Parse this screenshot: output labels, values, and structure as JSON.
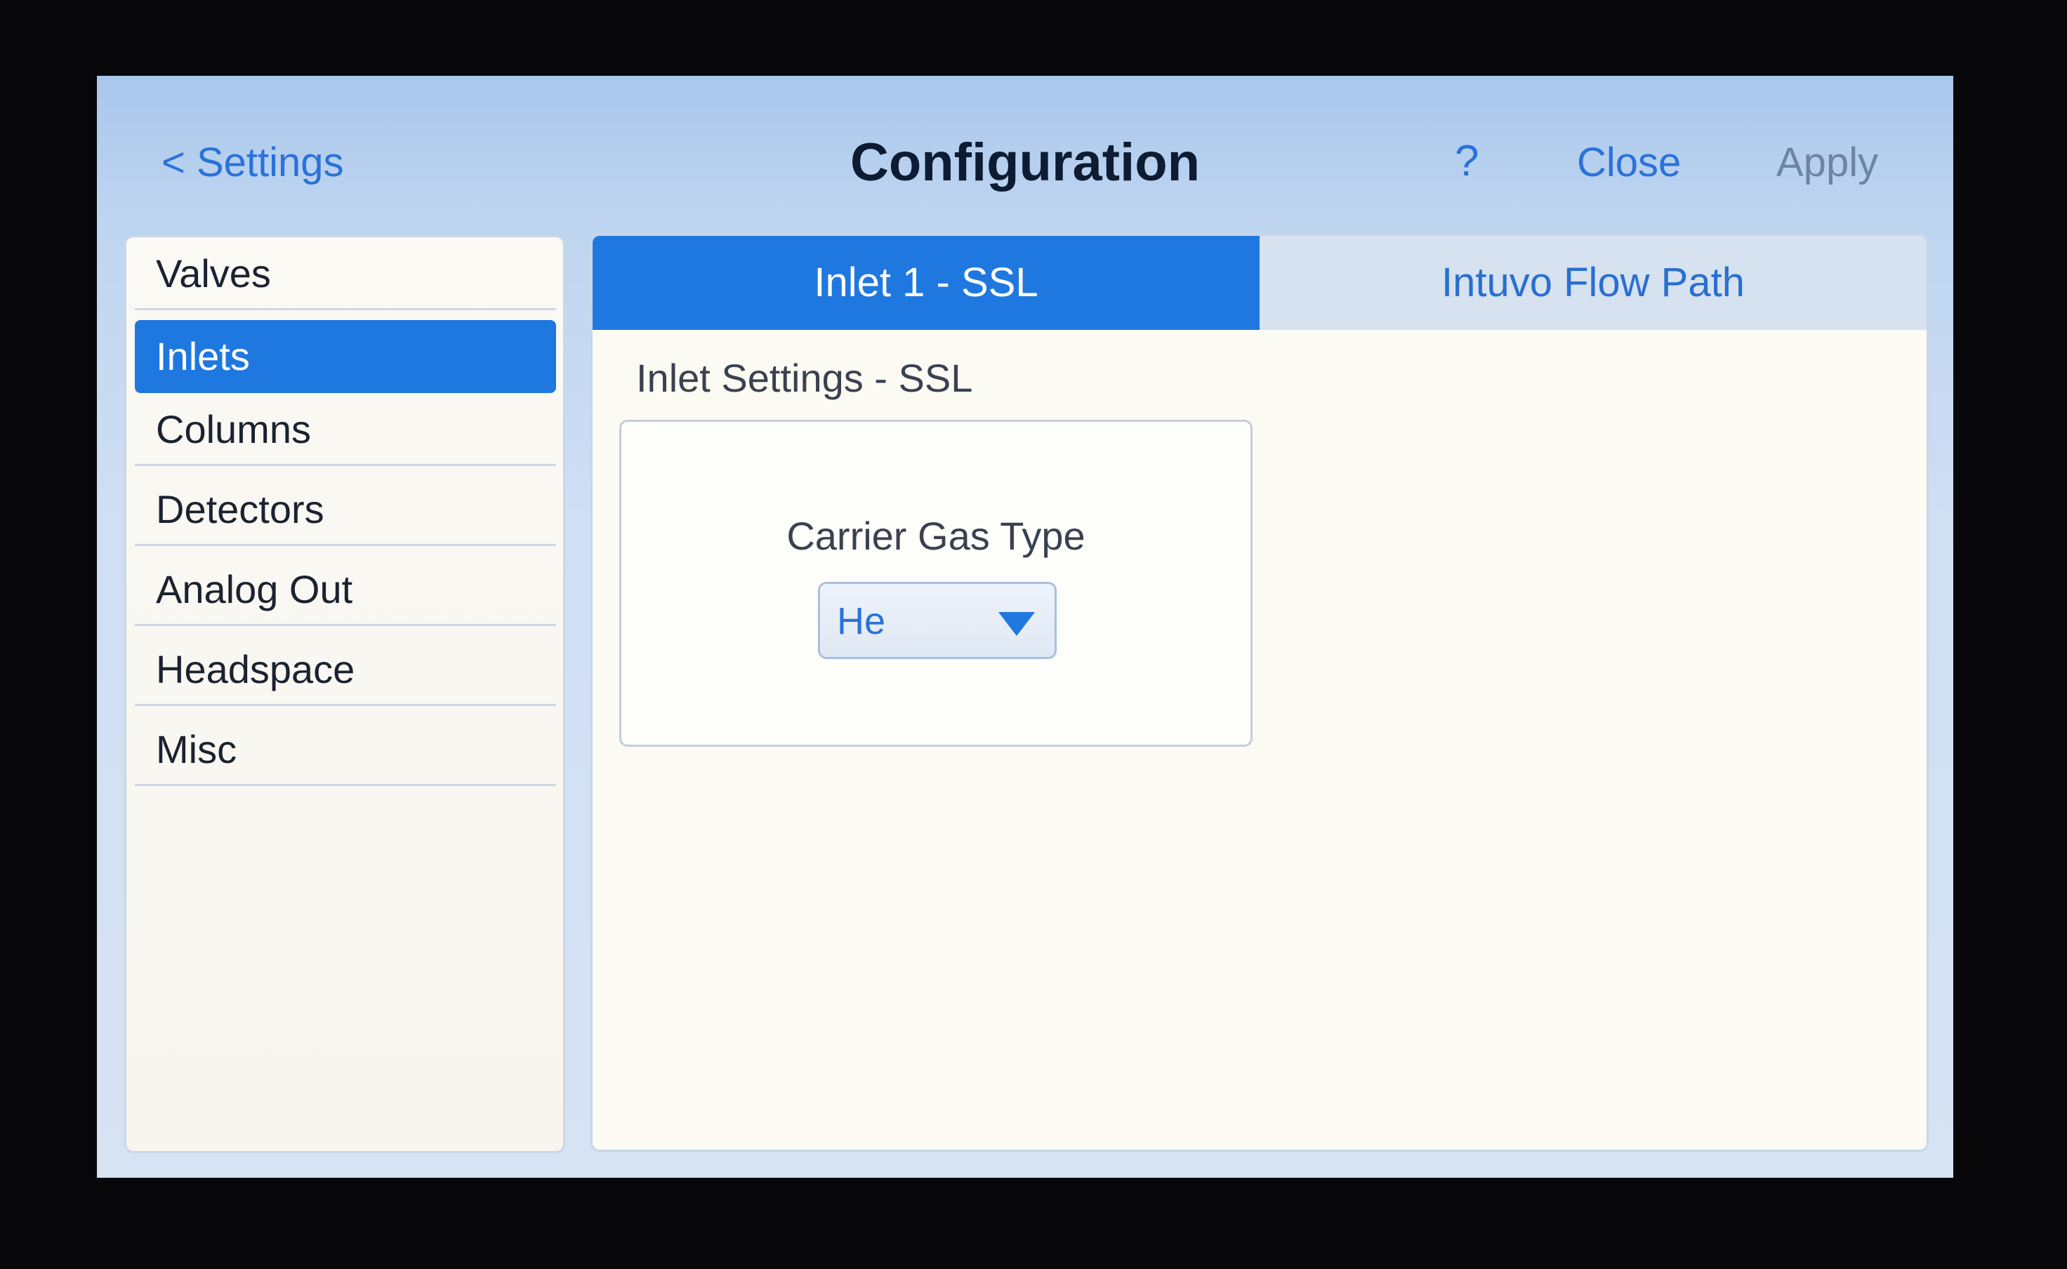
{
  "header": {
    "back_label": "< Settings",
    "title": "Configuration",
    "help_label": "?",
    "close_label": "Close",
    "apply_label": "Apply"
  },
  "sidebar": {
    "items": [
      {
        "label": "Valves",
        "selected": false
      },
      {
        "label": "Inlets",
        "selected": true
      },
      {
        "label": "Columns",
        "selected": false
      },
      {
        "label": "Detectors",
        "selected": false
      },
      {
        "label": "Analog Out",
        "selected": false
      },
      {
        "label": "Headspace",
        "selected": false
      },
      {
        "label": "Misc",
        "selected": false
      }
    ]
  },
  "tabs": [
    {
      "label": "Inlet 1 - SSL",
      "active": true
    },
    {
      "label": "Intuvo Flow Path",
      "active": false
    }
  ],
  "main": {
    "section_title": "Inlet Settings - SSL",
    "carrier_gas": {
      "label": "Carrier Gas Type",
      "value": "He",
      "icon": "chevron-down-triangle"
    }
  },
  "colors": {
    "accent": "#1f78e0",
    "link": "#2a72d9",
    "disabled": "#6f84a3"
  }
}
